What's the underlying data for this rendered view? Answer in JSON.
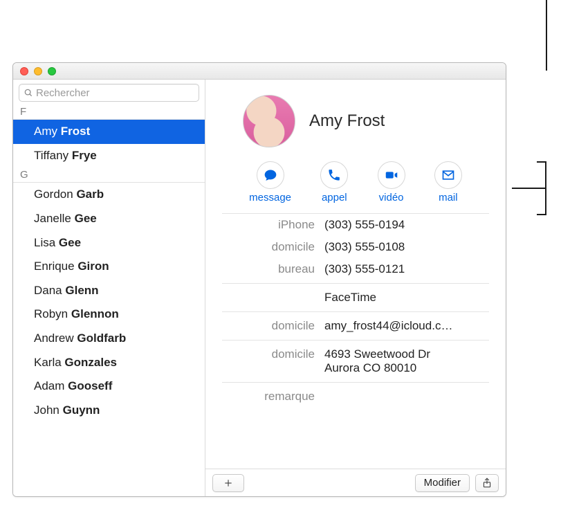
{
  "search": {
    "placeholder": "Rechercher"
  },
  "sidebar": {
    "sections": [
      {
        "letter": "F",
        "items": [
          {
            "first": "Amy",
            "last": "Frost",
            "selected": true
          },
          {
            "first": "Tiffany",
            "last": "Frye",
            "selected": false
          }
        ]
      },
      {
        "letter": "G",
        "items": [
          {
            "first": "Gordon",
            "last": "Garb"
          },
          {
            "first": "Janelle",
            "last": "Gee"
          },
          {
            "first": "Lisa",
            "last": "Gee"
          },
          {
            "first": "Enrique",
            "last": "Giron"
          },
          {
            "first": "Dana",
            "last": "Glenn"
          },
          {
            "first": "Robyn",
            "last": "Glennon"
          },
          {
            "first": "Andrew",
            "last": "Goldfarb"
          },
          {
            "first": "Karla",
            "last": "Gonzales"
          },
          {
            "first": "Adam",
            "last": "Gooseff"
          },
          {
            "first": "John",
            "last": "Guynn"
          }
        ]
      }
    ]
  },
  "contact": {
    "name": "Amy Frost",
    "actions": {
      "message": "message",
      "call": "appel",
      "video": "vidéo",
      "mail": "mail"
    },
    "fields": [
      {
        "label": "iPhone",
        "value": "(303) 555-0194",
        "sep": false
      },
      {
        "label": "domicile",
        "value": "(303) 555-0108",
        "sep": false
      },
      {
        "label": "bureau",
        "value": "(303) 555-0121",
        "sep": false
      },
      {
        "label": "",
        "value": "FaceTime",
        "sep": true
      },
      {
        "label": "domicile",
        "value": "amy_frost44@icloud.c…",
        "sep": true
      },
      {
        "label": "domicile",
        "value": "4693 Sweetwood Dr\nAurora CO 80010",
        "sep": true
      },
      {
        "label": "remarque",
        "value": "",
        "sep": true
      }
    ]
  },
  "footer": {
    "edit": "Modifier"
  }
}
